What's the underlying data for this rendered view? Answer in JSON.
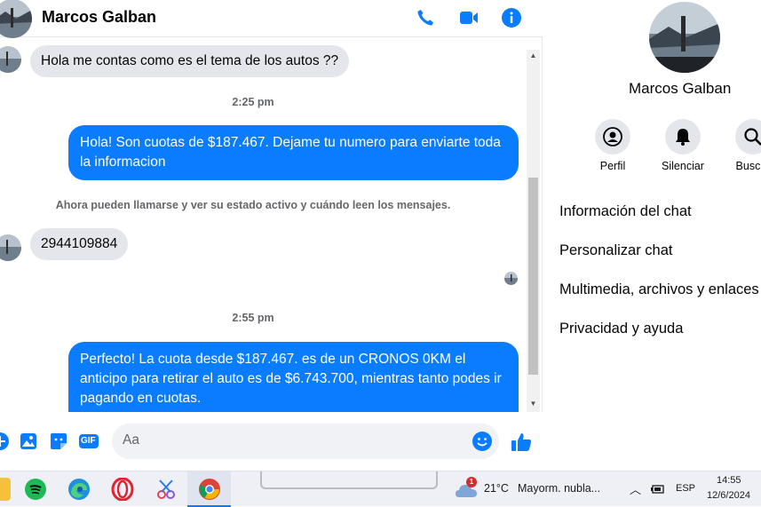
{
  "header": {
    "contact_name": "Marcos Galban"
  },
  "messages": {
    "m1": "Hola me contas como es el tema de los autos ??",
    "t1": "2:25 pm",
    "m2": "Hola! Son cuotas de $187.467. Dejame tu numero para enviarte toda la informacion",
    "system": "Ahora pueden llamarse y ver su estado activo y cuándo leen los mensajes.",
    "m3": "2944109884",
    "t2": "2:55 pm",
    "m4": "Perfecto! La cuota desde $187.467. es de un CRONOS 0KM el anticipo para retirar el auto es de $6.743.700, mientras tanto podes ir pagando en cuotas."
  },
  "composer": {
    "placeholder": "Aa",
    "gif_label": "GIF"
  },
  "side_panel": {
    "name": "Marcos Galban",
    "actions": [
      "Perfil",
      "Silenciar",
      "Buscar"
    ],
    "menu": [
      "Información del chat",
      "Personalizar chat",
      "Multimedia, archivos y enlaces",
      "Privacidad y ayuda"
    ]
  },
  "taskbar": {
    "weather_temp": "21°C",
    "weather_desc": "Mayorm. nubla...",
    "weather_badge": "1",
    "language": "ESP",
    "time": "14:55",
    "date": "12/6/2024"
  },
  "colors": {
    "accent": "#0a7cff",
    "incoming_bubble": "#e4e6eb"
  }
}
